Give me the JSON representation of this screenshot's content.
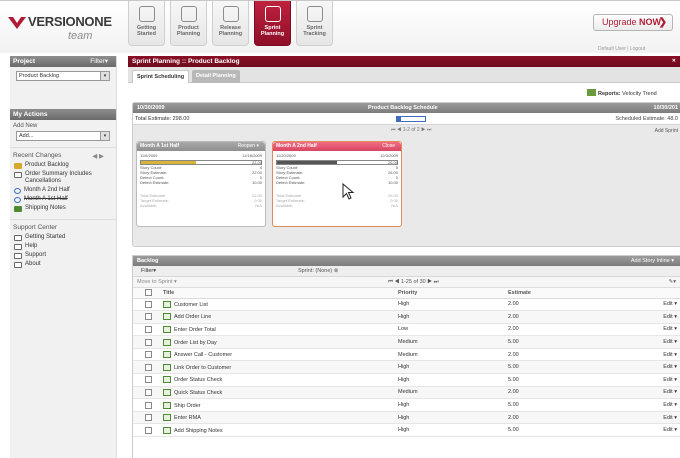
{
  "app": {
    "logo_name": "VERSIONONE",
    "logo_sub": "team"
  },
  "nav_tabs": [
    {
      "label_1": "Getting",
      "label_2": "Started",
      "icon": "home-icon"
    },
    {
      "label_1": "Product",
      "label_2": "Planning",
      "icon": "hierarchy-icon"
    },
    {
      "label_1": "Release",
      "label_2": "Planning",
      "icon": "release-icon"
    },
    {
      "label_1": "Sprint",
      "label_2": "Planning",
      "icon": "sprint-icon",
      "active": true
    },
    {
      "label_1": "Sprint",
      "label_2": "Tracking",
      "icon": "tracking-icon"
    }
  ],
  "header": {
    "upgrade_label": "Upgrade",
    "upgrade_bold": "NOW",
    "upgrade_chevron": "❯",
    "user_line": "Default User | Logout"
  },
  "sidebar": {
    "project_title": "Project",
    "project_filter": "Filter▾",
    "project_value": "Product Backlog",
    "actions_title": "My Actions",
    "add_new_label": "Add New",
    "add_new_value": "Add...",
    "recent_title": "Recent Changes",
    "recent_nav": "◀  ▶",
    "recent_items": [
      {
        "label": "Product Backlog",
        "icon": "folder",
        "strike": false
      },
      {
        "label": "Order Summary Includes Cancellations",
        "icon": "page",
        "strike": false
      },
      {
        "label": "Month A 2nd Half",
        "icon": "loop",
        "strike": false
      },
      {
        "label": "Month A 1st Half",
        "icon": "loop",
        "strike": true
      },
      {
        "label": "Shipping Notes",
        "icon": "story",
        "strike": false
      }
    ],
    "support_title": "Support Center",
    "support_items": [
      {
        "label": "Getting Started",
        "icon": "home-icon"
      },
      {
        "label": "Help",
        "icon": "help-icon"
      },
      {
        "label": "Support",
        "icon": "support-icon"
      },
      {
        "label": "About",
        "icon": "about-icon"
      }
    ]
  },
  "main": {
    "title": "Sprint Planning :: Product Backlog",
    "subtabs": [
      "Sprint Scheduling",
      "Detail Planning"
    ],
    "reports_label": "Reports:",
    "reports_value": "Velocity Trend",
    "schedule": {
      "date_left": "10/30/2009",
      "title": "Product Backlog Schedule",
      "date_right": "10/30/201",
      "total_estimate": "Total Estimate: 298.00",
      "scheduled_estimate": "Scheduled Estimate: 48.0",
      "bar_fill": 0.16,
      "pager": "⏮ ◀ 1-2 of 2 ▶ ⏭",
      "add_sprint": "Add Sprint"
    },
    "sprints": [
      {
        "title": "Month A 1st Half",
        "state": "Reopen ▾",
        "start": "11/6/2009",
        "end": "11/18/2009",
        "bar_value": "22.00",
        "bar_fill": 0.46,
        "rows": [
          [
            "Story Count:",
            "4"
          ],
          [
            "Story Estimate:",
            "22.00"
          ],
          [
            "Defect Count:",
            "0"
          ],
          [
            "Defect Estimate:",
            "10.00"
          ]
        ],
        "totals": [
          [
            "Total Estimate:",
            "22.00"
          ],
          [
            "Target Estimate:",
            "0.00"
          ],
          [
            "Available:",
            "N/A"
          ]
        ]
      },
      {
        "title": "Month A 2nd Half",
        "state": "Close",
        "start": "11/20/2009",
        "end": "12/3/2009",
        "bar_value": "26.00",
        "bar_fill": 0.5,
        "rows": [
          [
            "Story Count:",
            "5"
          ],
          [
            "Story Estimate:",
            "26.00"
          ],
          [
            "Defect Count:",
            "0"
          ],
          [
            "Defect Estimate:",
            "10.00"
          ]
        ],
        "totals": [
          [
            "Total Estimate:",
            "26.00"
          ],
          [
            "Target Estimate:",
            "0.00"
          ],
          [
            "Available:",
            "N/A"
          ]
        ]
      }
    ],
    "backlog": {
      "title": "Backlog",
      "add_inline": "Add Story Inline ▾",
      "filter": "Filter▾",
      "sprint_filter": "Sprint: (None) ⊗",
      "move_to": "Move to Sprint ▾",
      "pager": "⏮ ◀ 1-25 of 30 ▶ ⏭",
      "tools": "✎▾",
      "columns": [
        "Title",
        "Priority",
        "Estimate"
      ],
      "rows": [
        {
          "title": "Customer List",
          "priority": "High",
          "estimate": "2.00",
          "action": "Edit ▾"
        },
        {
          "title": "Add Order Line",
          "priority": "High",
          "estimate": "2.00",
          "action": "Edit ▾"
        },
        {
          "title": "Enter Order Total",
          "priority": "Low",
          "estimate": "2.00",
          "action": "Edit ▾"
        },
        {
          "title": "Order List by Day",
          "priority": "Medium",
          "estimate": "5.00",
          "action": "Edit ▾"
        },
        {
          "title": "Answer Call - Customer",
          "priority": "Medium",
          "estimate": "2.00",
          "action": "Edit ▾"
        },
        {
          "title": "Link Order to Customer",
          "priority": "High",
          "estimate": "5.00",
          "action": "Edit ▾"
        },
        {
          "title": "Order Status Check",
          "priority": "High",
          "estimate": "5.00",
          "action": "Edit ▾"
        },
        {
          "title": "Quick Status Check",
          "priority": "Medium",
          "estimate": "2.00",
          "action": "Edit ▾"
        },
        {
          "title": "Ship Order",
          "priority": "High",
          "estimate": "5.00",
          "action": "Edit ▾"
        },
        {
          "title": "Enter RMA",
          "priority": "High",
          "estimate": "2.00",
          "action": "Edit ▾"
        },
        {
          "title": "Add Shipping Notes",
          "priority": "High",
          "estimate": "5.00",
          "action": "Edit ▾"
        }
      ]
    }
  },
  "colors": {
    "brand": "#b01c35",
    "header_dark": "#7c0c22",
    "accent_blue": "#3d6fbf",
    "story_green": "#4e8a34"
  }
}
